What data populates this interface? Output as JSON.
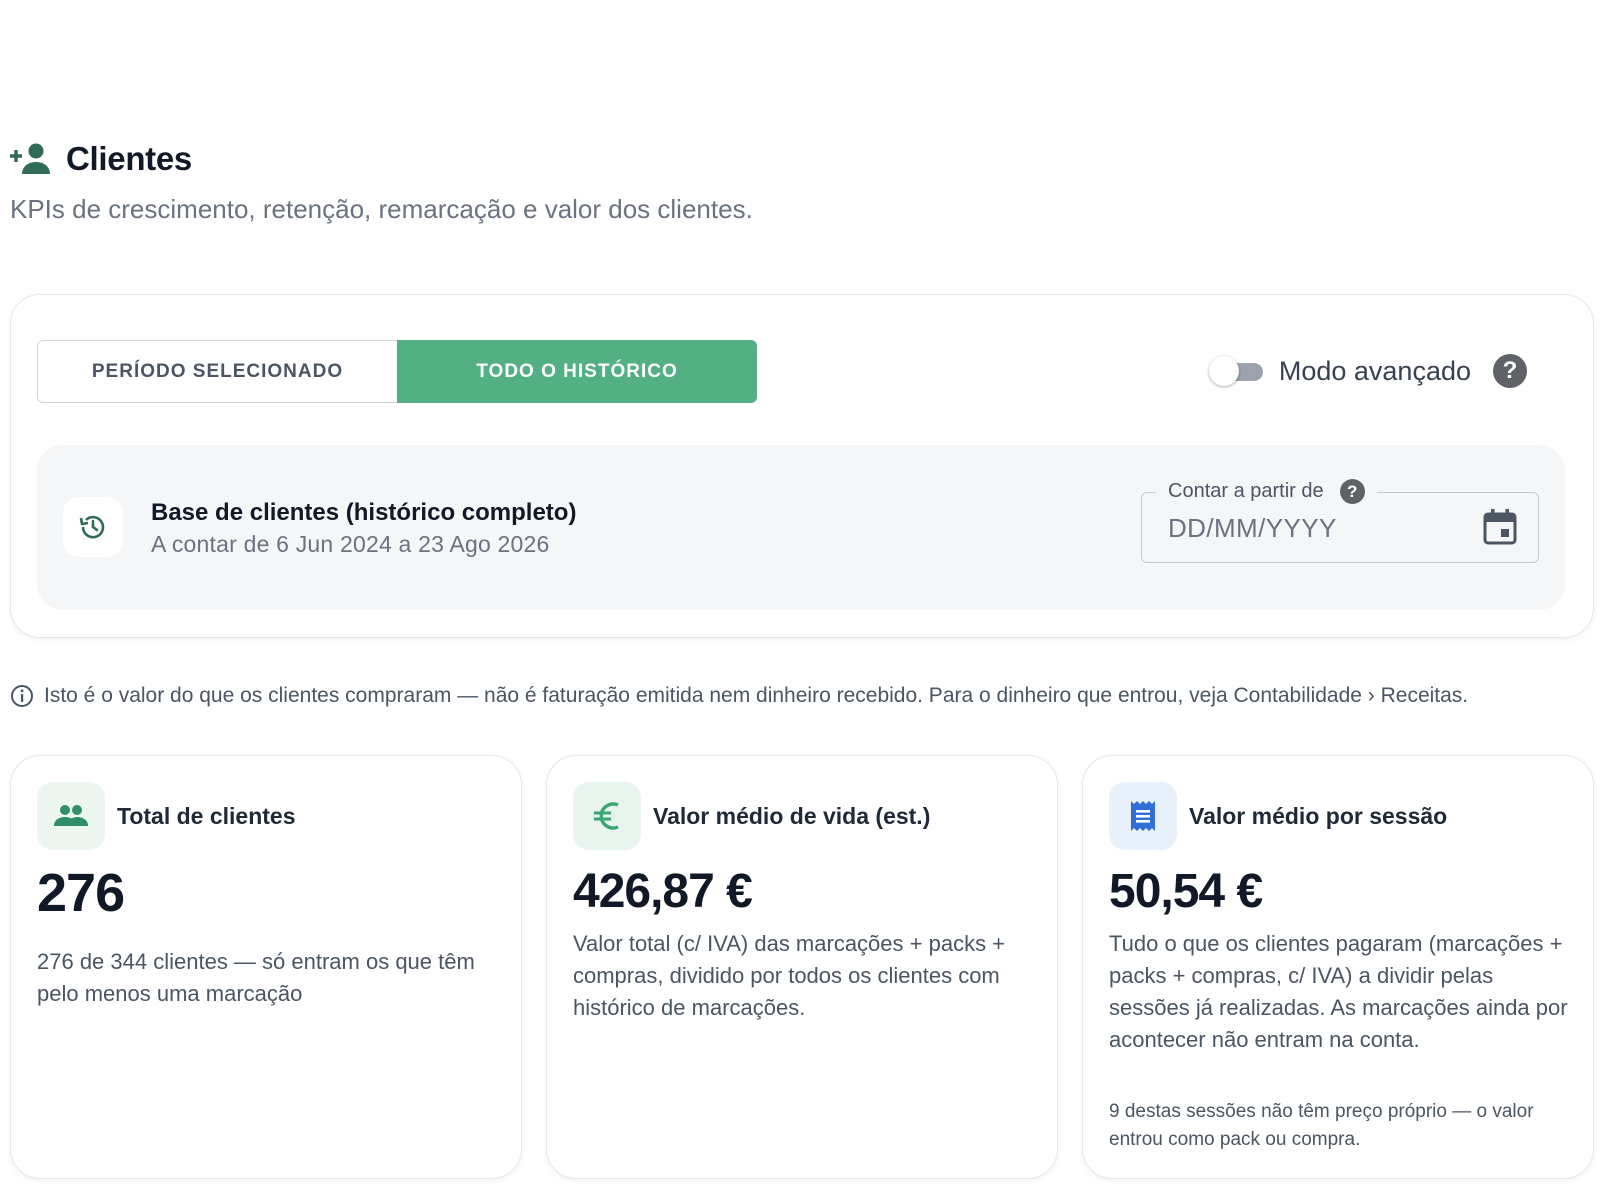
{
  "page": {
    "title": "Clientes",
    "subtitle": "KPIs de crescimento, retenção, remarcação e valor dos clientes."
  },
  "filters": {
    "tabs": [
      {
        "label": "PERÍODO SELECIONADO",
        "active": false
      },
      {
        "label": "TODO O HISTÓRICO",
        "active": true
      }
    ],
    "advanced_mode": {
      "label": "Modo avançado",
      "enabled": false
    },
    "help_glyph": "?"
  },
  "base": {
    "title": "Base de clientes (histórico completo)",
    "subtitle": "A contar de 6 Jun 2024 a 23 Ago 2026",
    "date_field": {
      "label": "Contar a partir de",
      "placeholder": "DD/MM/YYYY",
      "value": ""
    }
  },
  "info_note": "Isto é o valor do que os clientes compraram — não é faturação emitida nem dinheiro recebido. Para o dinheiro que entrou, veja Contabilidade › Receitas.",
  "kpis": [
    {
      "icon": "people-icon",
      "icon_bg": "#eef6f2",
      "icon_color": "#2f8f6a",
      "label": "Total de clientes",
      "value": "276",
      "description": "276 de 344 clientes — só entram os que têm pelo menos uma marcação"
    },
    {
      "icon": "euro-icon",
      "icon_bg": "#e8f5ee",
      "icon_color": "#3aa672",
      "label": "Valor médio de vida (est.)",
      "value": "426,87 €",
      "description": "Valor total (c/ IVA) das marcações + packs + compras, dividido por todos os clientes com histórico de marcações."
    },
    {
      "icon": "receipt-icon",
      "icon_bg": "#e8f0fc",
      "icon_color": "#2f6fd6",
      "label": "Valor médio por sessão",
      "value": "50,54 €",
      "description": "Tudo o que os clientes pagaram (marcações + packs + compras, c/ IVA) a dividir pelas sessões já realizadas. As marcações ainda por acontecer não entram na conta.",
      "footnote": "9 destas sessões não têm preço próprio — o valor entrou como pack ou compra."
    }
  ],
  "colors": {
    "accent": "#52b083",
    "dark_green": "#2f6b55"
  }
}
